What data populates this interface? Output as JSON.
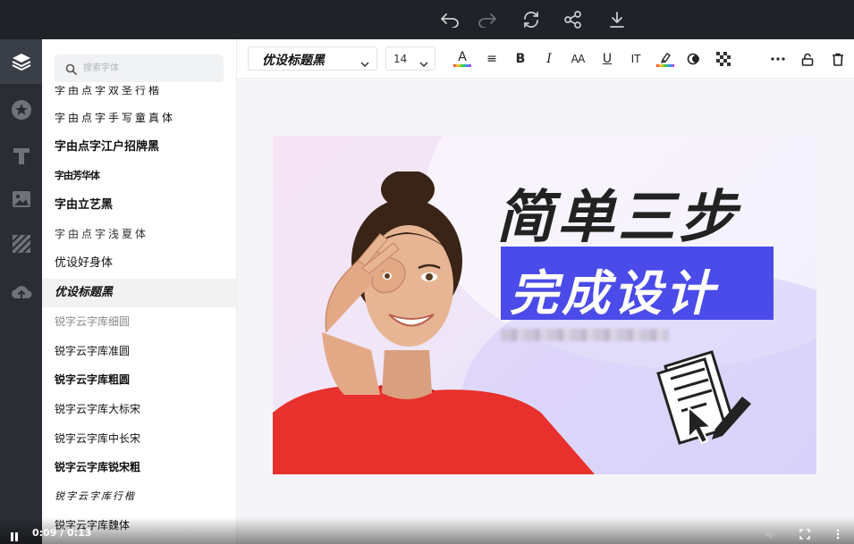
{
  "topbar": {
    "icons": [
      "undo-icon",
      "redo-icon",
      "refresh-icon",
      "share-icon",
      "download-icon"
    ]
  },
  "rail": {
    "items": [
      "layers-icon",
      "star-icon",
      "text-icon",
      "image-icon",
      "texture-icon",
      "upload-icon"
    ]
  },
  "search": {
    "placeholder": "搜索字体"
  },
  "fonts": [
    "字由点字双圣行楷",
    "字由点字手写童真体",
    "字由点字江户招牌黑",
    "字由芳华体",
    "字由立艺黑",
    "字由点字浅夏体",
    "优设好身体",
    "优设标题黑",
    "锐字云字库细圆",
    "锐字云字库准圆",
    "锐字云字库粗圆",
    "锐字云字库大标宋",
    "锐字云字库中长宋",
    "锐字云字库锐宋粗",
    "锐字云字库行楷",
    "锐字云字库魏体"
  ],
  "toolbar": {
    "font_name": "优设标题黑",
    "font_size": "14",
    "tools": [
      "A",
      "≡",
      "B",
      "I",
      "AA",
      "U",
      "IT"
    ]
  },
  "artboard": {
    "headline": "简单三步",
    "subheadline": "完成设计"
  },
  "video": {
    "time": "0:09 / 0:13"
  },
  "colors": {
    "topbar": "#1f2227",
    "rail": "#2a2d33",
    "accent_blue": "#4a4be8",
    "shirt_red": "#e8302c"
  }
}
